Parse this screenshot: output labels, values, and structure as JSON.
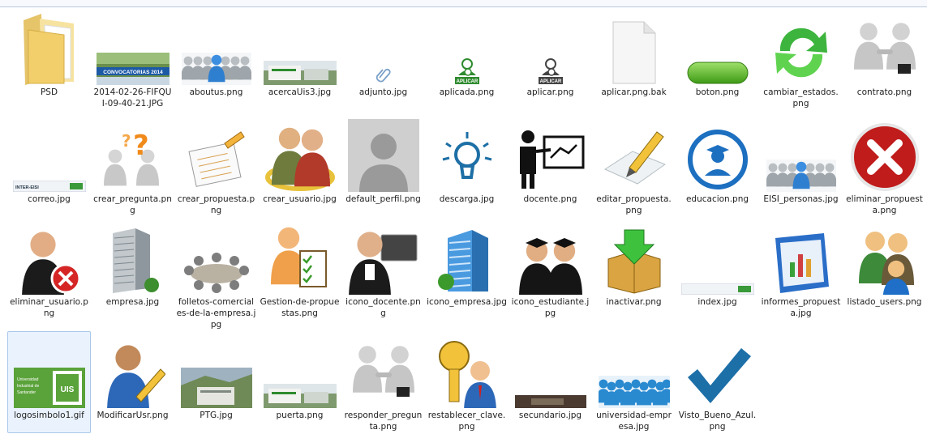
{
  "files": [
    {
      "label": "PSD",
      "icon": "folder-icon"
    },
    {
      "label": "2014-02-26-FIFQUI-09-40-21.JPG",
      "icon": "banner-photo-icon",
      "banner_text": "CONVOCATORIAS 2014"
    },
    {
      "label": "aboutus.png",
      "icon": "people-group-icon"
    },
    {
      "label": "acercaUis3.jpg",
      "icon": "building-strip-icon"
    },
    {
      "label": "adjunto.jpg",
      "icon": "paperclip-icon"
    },
    {
      "label": "aplicada.png",
      "icon": "user-check-icon",
      "badge_text": "APLICAR",
      "color": "#2e8b2e"
    },
    {
      "label": "aplicar.png",
      "icon": "user-check-icon",
      "badge_text": "APLICAR",
      "color": "#444444"
    },
    {
      "label": "aplicar.png.bak",
      "icon": "blank-file-icon"
    },
    {
      "label": "boton.png",
      "icon": "green-button-icon"
    },
    {
      "label": "cambiar_estados.png",
      "icon": "refresh-arrows-icon"
    },
    {
      "label": "contrato.png",
      "icon": "handshake-icon"
    },
    {
      "label": "correo.jpg",
      "icon": "web-strip-icon",
      "strip_text": "INTER-EISI"
    },
    {
      "label": "crear_pregunta.png",
      "icon": "question-figures-icon"
    },
    {
      "label": "crear_propuesta.png",
      "icon": "edit-document-icon"
    },
    {
      "label": "crear_usuario.jpg",
      "icon": "users-gold-ring-icon"
    },
    {
      "label": "default_perfil.png",
      "icon": "profile-silhouette-icon"
    },
    {
      "label": "descarga.jpg",
      "icon": "lightbulb-icon"
    },
    {
      "label": "docente.png",
      "icon": "teacher-board-icon"
    },
    {
      "label": "editar_propuesta.png",
      "icon": "pencil-paper-icon"
    },
    {
      "label": "educacion.png",
      "icon": "graduate-circle-icon"
    },
    {
      "label": "EISI_personas.jpg",
      "icon": "people-group-icon"
    },
    {
      "label": "eliminar_propuesta.png",
      "icon": "red-x-circle-icon"
    },
    {
      "label": "eliminar_usuario.png",
      "icon": "user-delete-icon"
    },
    {
      "label": "empresa.jpg",
      "icon": "office-building-icon"
    },
    {
      "label": "folletos-comerciales-de-la-empresa.jpg",
      "icon": "meeting-table-icon"
    },
    {
      "label": "Gestion-de-propuestas.png",
      "icon": "person-checklist-icon"
    },
    {
      "label": "icono_docente.png",
      "icon": "businessman-laptop-icon"
    },
    {
      "label": "icono_empresa.jpg",
      "icon": "blue-tower-icon"
    },
    {
      "label": "icono_estudiante.jpg",
      "icon": "graduates-icon"
    },
    {
      "label": "inactivar.png",
      "icon": "box-arrow-icon"
    },
    {
      "label": "index.jpg",
      "icon": "web-strip-icon",
      "strip_text": ""
    },
    {
      "label": "informes_propuesta.jpg",
      "icon": "reports-folder-icon"
    },
    {
      "label": "listado_users.png",
      "icon": "users-list-icon"
    },
    {
      "label": "logosimbolo1.gif",
      "icon": "uis-logo-icon",
      "logo_text": "Universidad Industrial de Santander",
      "logo_mark": "UIS"
    },
    {
      "label": "ModificarUsr.png",
      "icon": "user-edit-icon"
    },
    {
      "label": "PTG.jpg",
      "icon": "campus-photo-icon"
    },
    {
      "label": "puerta.png",
      "icon": "building-strip-icon"
    },
    {
      "label": "responder_pregunta.png",
      "icon": "handshake-icon"
    },
    {
      "label": "restablecer_clave.png",
      "icon": "key-user-icon"
    },
    {
      "label": "secundario.jpg",
      "icon": "dark-strip-icon"
    },
    {
      "label": "universidad-empresa.jpg",
      "icon": "crowd-silhouette-icon"
    },
    {
      "label": "Visto_Bueno_Azul.png",
      "icon": "blue-check-icon"
    }
  ],
  "rows": [
    [
      0,
      1,
      2,
      3,
      4,
      5,
      6,
      7,
      8,
      9,
      10
    ],
    [
      11,
      12,
      13,
      14,
      15,
      16,
      17,
      18,
      19,
      20,
      21
    ],
    [
      22,
      23,
      24,
      25,
      26,
      27,
      28,
      29,
      30,
      31,
      32
    ],
    [
      33,
      34,
      35,
      36,
      37,
      38,
      39,
      40,
      41
    ]
  ],
  "selected_index": 33
}
